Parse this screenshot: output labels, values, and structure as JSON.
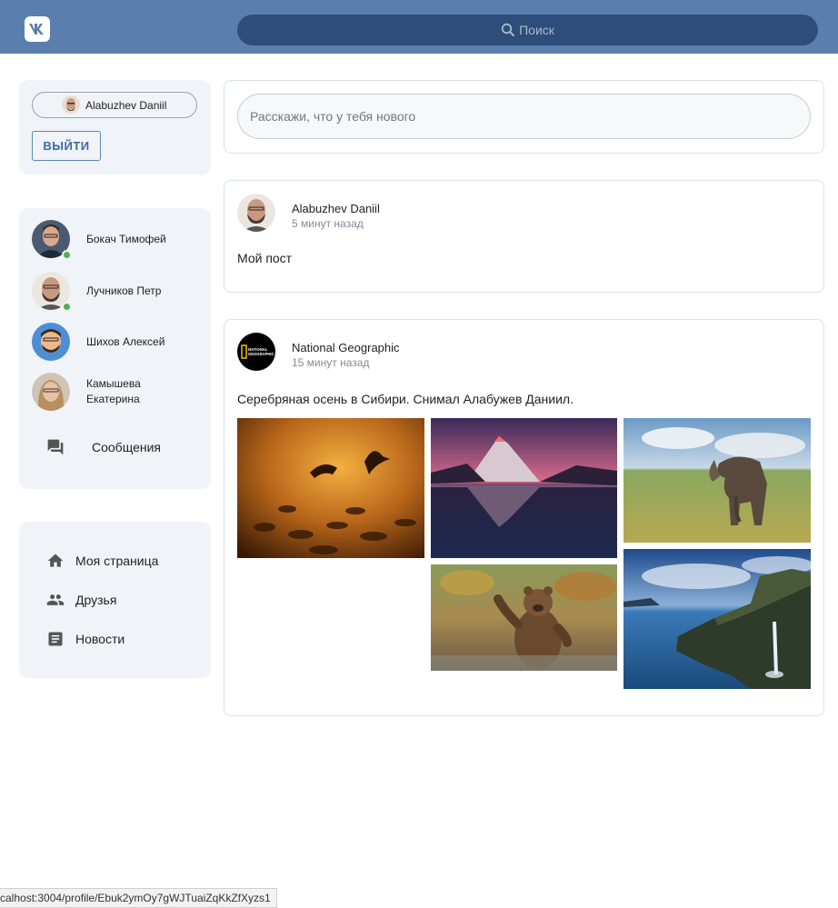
{
  "header": {
    "logo_text": "VK",
    "search_placeholder": "Поиск"
  },
  "profile": {
    "user_name": "Alabuzhev Daniil",
    "logout_label": "ВЫЙТИ"
  },
  "friends": [
    {
      "name": "Бокач Тимофей",
      "online": true
    },
    {
      "name": "Лучников Петр",
      "online": true
    },
    {
      "name": "Шихов Алексей",
      "online": false
    },
    {
      "name": "Камышева Екатерина",
      "online": false
    }
  ],
  "messages_label": "Сообщения",
  "nav": {
    "my_page": "Моя страница",
    "friends": "Друзья",
    "news": "Новости"
  },
  "composer": {
    "placeholder": "Расскажи, что у тебя нового"
  },
  "posts": [
    {
      "author": "Alabuzhev Daniil",
      "time": "5 минут назад",
      "text": "Мой пост"
    },
    {
      "author": "National Geographic",
      "time": "15 минут назад",
      "text": "Серебряная осень в Сибири. Снимал Алабужев Даниил.",
      "logo_text": "NATIONAL GEOGRAPHIC"
    }
  ],
  "status_url": "calhost:3004/profile/Ebuk2ymOy7gWJTuaiZqKkZfXyzs1",
  "colors": {
    "header": "#5a7fae",
    "search": "#2f4d7a",
    "card": "#f0f3f7",
    "online": "#4bb34b",
    "accent": "#3b6aa0"
  }
}
